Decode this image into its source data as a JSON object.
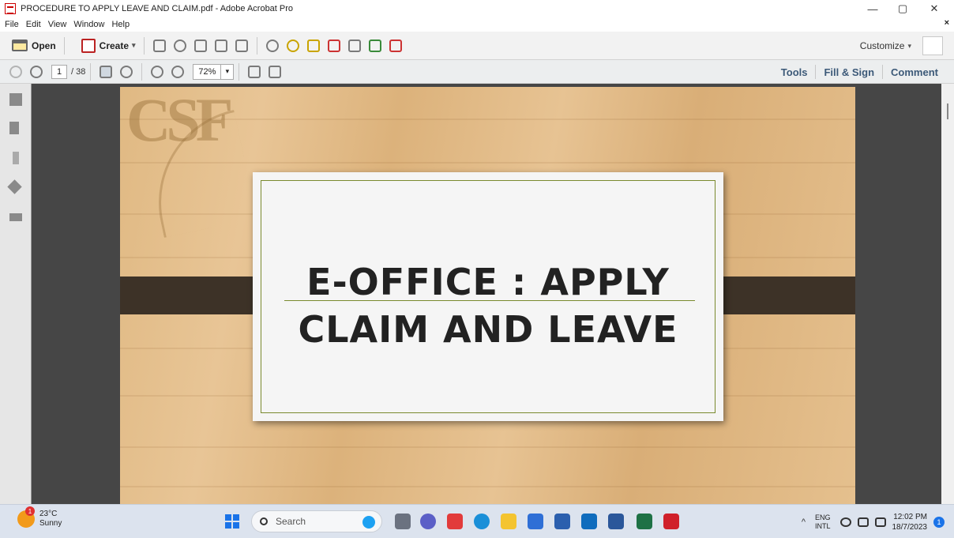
{
  "window": {
    "title": "PROCEDURE TO APPLY LEAVE AND CLAIM.pdf - Adobe Acrobat Pro",
    "minimize": "—",
    "restore": "▢",
    "close": "✕"
  },
  "menu": {
    "items": [
      "File",
      "Edit",
      "View",
      "Window",
      "Help"
    ],
    "close": "×"
  },
  "toolbar": {
    "open_label": "Open",
    "create_label": "Create",
    "dropdown": "▾",
    "customize_label": "Customize"
  },
  "nav": {
    "current_page": "1",
    "total_pages": "/ 38",
    "zoom": "72%",
    "zoom_dd": "▾"
  },
  "panels": {
    "tools": "Tools",
    "fill_sign": "Fill & Sign",
    "comment": "Comment"
  },
  "document": {
    "logo": "CSF",
    "title_line1": "E-OFFICE : APPLY",
    "title_line2": "CLAIM AND LEAVE"
  },
  "taskbar": {
    "weather_badge": "1",
    "temperature": "23°C",
    "condition": "Sunny",
    "search_placeholder": "Search",
    "tray_chevron": "^",
    "lang1": "ENG",
    "lang2": "INTL",
    "time": "12:02 PM",
    "date": "18/7/2023",
    "notification_count": "1"
  },
  "colors": {
    "link": "#3c5978",
    "band": "#3d3227",
    "card_border": "#7a8a2e",
    "taskbar": "#dce3ee"
  }
}
